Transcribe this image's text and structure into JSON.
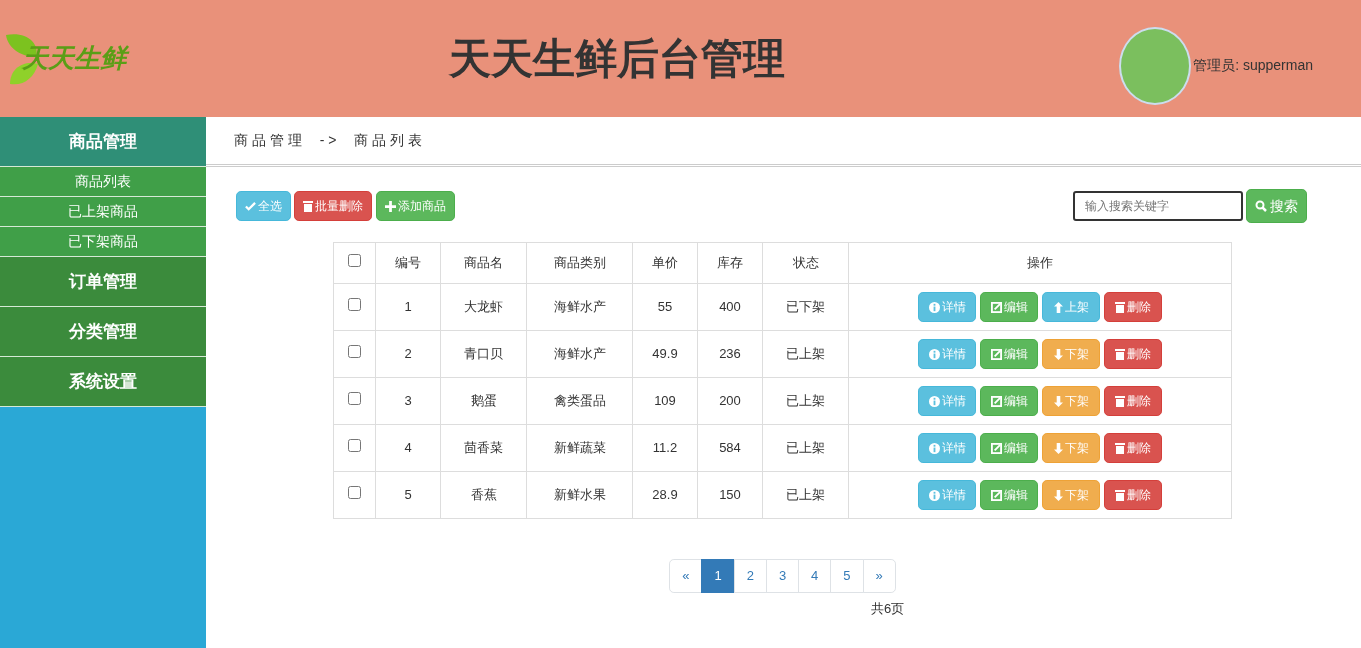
{
  "header": {
    "logo_text": "天天生鲜",
    "title": "天天生鲜后台管理",
    "admin_label": "管理员: supperman"
  },
  "sidebar": [
    {
      "label": "商品管理",
      "expanded": true,
      "children": [
        {
          "label": "商品列表"
        },
        {
          "label": "已上架商品"
        },
        {
          "label": "已下架商品"
        }
      ]
    },
    {
      "label": "订单管理",
      "expanded": false
    },
    {
      "label": "分类管理",
      "expanded": false
    },
    {
      "label": "系统设置",
      "expanded": false
    }
  ],
  "breadcrumb": [
    "商 品 管 理",
    "- >",
    "商 品 列 表"
  ],
  "toolbar": [
    {
      "kind": "select-all",
      "label": "全选"
    },
    {
      "kind": "delete",
      "label": "批量删除"
    },
    {
      "kind": "add",
      "label": "添加商品"
    }
  ],
  "search": {
    "placeholder": "输入搜索关键字",
    "button": "搜索"
  },
  "table": {
    "select_all_checked": false,
    "columns": [
      "编号",
      "商品名",
      "商品类别",
      "单价",
      "库存",
      "状态",
      "操作"
    ],
    "rows": [
      {
        "checked": false,
        "cells": [
          "1",
          "大龙虾",
          "海鲜水产",
          "55",
          "400",
          "已下架"
        ],
        "actions": [
          {
            "kind": "detail",
            "label": "详情"
          },
          {
            "kind": "edit",
            "label": "编辑"
          },
          {
            "kind": "shelve-up",
            "label": "上架"
          },
          {
            "kind": "delete",
            "label": "删除"
          }
        ]
      },
      {
        "checked": false,
        "cells": [
          "2",
          "青口贝",
          "海鲜水产",
          "49.9",
          "236",
          "已上架"
        ],
        "actions": [
          {
            "kind": "detail",
            "label": "详情"
          },
          {
            "kind": "edit",
            "label": "编辑"
          },
          {
            "kind": "shelve-down",
            "label": "下架"
          },
          {
            "kind": "delete",
            "label": "删除"
          }
        ]
      },
      {
        "checked": false,
        "cells": [
          "3",
          "鹅蛋",
          "禽类蛋品",
          "109",
          "200",
          "已上架"
        ],
        "actions": [
          {
            "kind": "detail",
            "label": "详情"
          },
          {
            "kind": "edit",
            "label": "编辑"
          },
          {
            "kind": "shelve-down",
            "label": "下架"
          },
          {
            "kind": "delete",
            "label": "删除"
          }
        ]
      },
      {
        "checked": false,
        "cells": [
          "4",
          "茴香菜",
          "新鲜蔬菜",
          "11.2",
          "584",
          "已上架"
        ],
        "actions": [
          {
            "kind": "detail",
            "label": "详情"
          },
          {
            "kind": "edit",
            "label": "编辑"
          },
          {
            "kind": "shelve-down",
            "label": "下架"
          },
          {
            "kind": "delete",
            "label": "删除"
          }
        ]
      },
      {
        "checked": false,
        "cells": [
          "5",
          "香蕉",
          "新鲜水果",
          "28.9",
          "150",
          "已上架"
        ],
        "actions": [
          {
            "kind": "detail",
            "label": "详情"
          },
          {
            "kind": "edit",
            "label": "编辑"
          },
          {
            "kind": "shelve-down",
            "label": "下架"
          },
          {
            "kind": "delete",
            "label": "删除"
          }
        ]
      }
    ]
  },
  "pagination": {
    "prev": "«",
    "next": "»",
    "pages": [
      {
        "label": "1",
        "selected": true
      },
      {
        "label": "2",
        "selected": false
      },
      {
        "label": "3",
        "selected": false
      },
      {
        "label": "4",
        "selected": false
      },
      {
        "label": "5",
        "selected": false
      }
    ],
    "total": "共6页"
  }
}
